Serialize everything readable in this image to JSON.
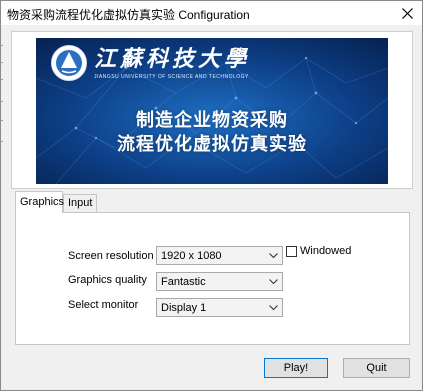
{
  "window": {
    "title": "物资采购流程优化虚拟仿真实验 Configuration"
  },
  "banner": {
    "logo_text": "江蘇科技大學",
    "logo_subtext": "JIANGSU UNIVERSITY OF SCIENCE AND TECHNOLOGY",
    "title_line1": "制造企业物资采购",
    "title_line2": "流程优化虚拟仿真实验",
    "background_color": "#0a2a5c",
    "accent_color": "#1a67b8"
  },
  "tabs": [
    {
      "label": "Graphics",
      "selected": true
    },
    {
      "label": "Input",
      "selected": false
    }
  ],
  "graphics": {
    "resolution_label": "Screen resolution",
    "resolution_value": "1920 x 1080",
    "quality_label": "Graphics quality",
    "quality_value": "Fantastic",
    "monitor_label": "Select monitor",
    "monitor_value": "Display 1",
    "windowed_label": "Windowed",
    "windowed_checked": false
  },
  "buttons": {
    "play": "Play!",
    "quit": "Quit"
  },
  "icons": {
    "close": "close-icon",
    "dropdown": "chevron-down-icon",
    "logo": "university-emblem-icon"
  }
}
